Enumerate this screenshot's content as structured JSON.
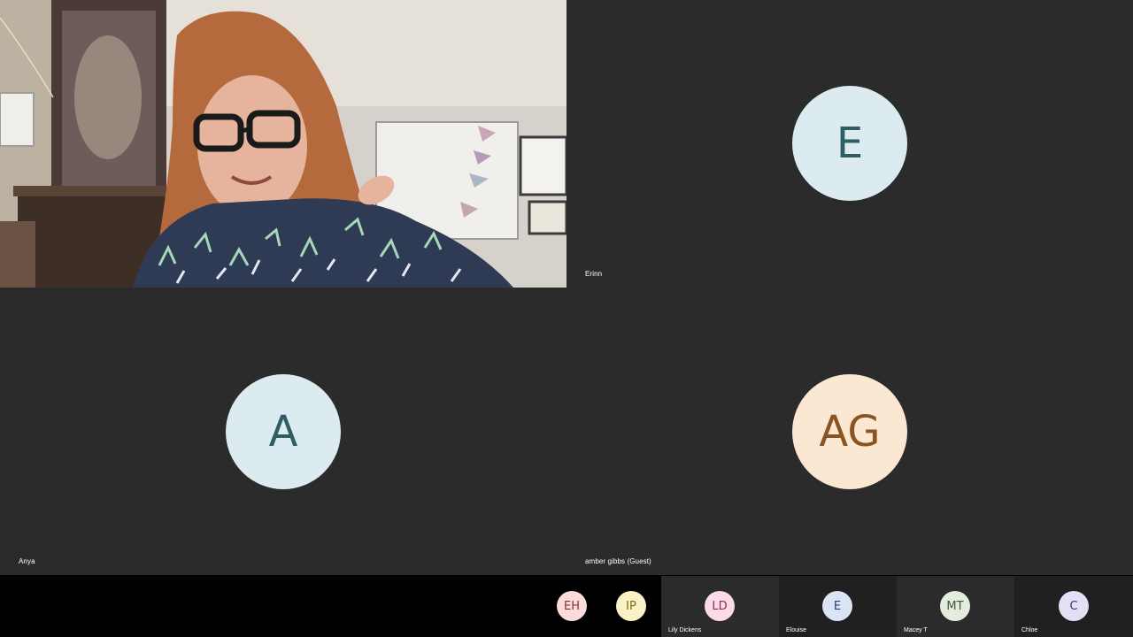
{
  "tiles": {
    "video": {
      "name": ""
    },
    "erinn": {
      "name": "Erinn",
      "initials": "E",
      "bg": "#dcebef",
      "fg": "#2e5e64"
    },
    "anya": {
      "name": "Anya",
      "initials": "A",
      "bg": "#dcebef",
      "fg": "#2e5e64"
    },
    "amber": {
      "name": "amber gibbs (Guest)",
      "initials": "AG",
      "bg": "#fbe8d3",
      "fg": "#8a5422"
    }
  },
  "strip": [
    {
      "initials": "EH",
      "name": "",
      "bg": "#fadbdb",
      "fg": "#8a2e2e"
    },
    {
      "initials": "IP",
      "name": "",
      "bg": "#fbf1c7",
      "fg": "#7a6a12"
    },
    {
      "initials": "LD",
      "name": "Lily Dickens",
      "bg": "#fadbe7",
      "fg": "#8a2e55"
    },
    {
      "initials": "E",
      "name": "Elouise",
      "bg": "#dbe4f5",
      "fg": "#2e3f6e"
    },
    {
      "initials": "MT",
      "name": "Macey T",
      "bg": "#e4ece0",
      "fg": "#3d5a30"
    },
    {
      "initials": "C",
      "name": "Chloe",
      "bg": "#e2e0f5",
      "fg": "#3a3470"
    }
  ]
}
